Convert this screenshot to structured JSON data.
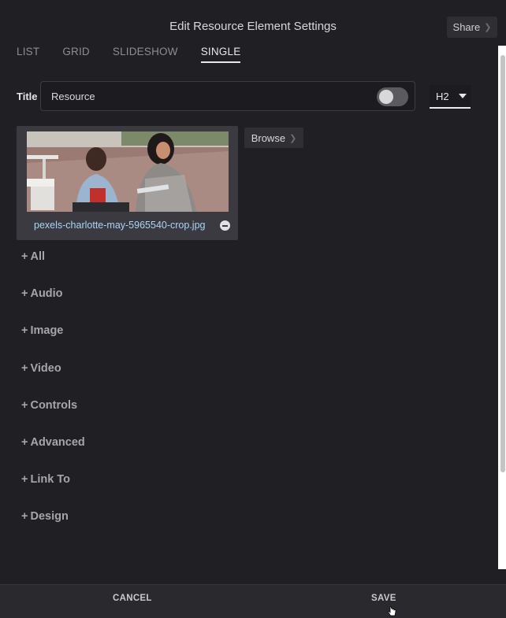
{
  "header": {
    "title": "Edit Resource Element Settings",
    "share_label": "Share"
  },
  "tabs": [
    {
      "label": "LIST",
      "active": false
    },
    {
      "label": "GRID",
      "active": false
    },
    {
      "label": "SLIDESHOW",
      "active": false
    },
    {
      "label": "SINGLE",
      "active": true
    }
  ],
  "title_field": {
    "label": "Title",
    "value": "Resource",
    "toggle_on": false
  },
  "heading_select": {
    "value": "H2"
  },
  "resource": {
    "file_name": "pexels-charlotte-may-5965540-crop.jpg",
    "browse_label": "Browse"
  },
  "sections": [
    "All",
    "Audio",
    "Image",
    "Video",
    "Controls",
    "Advanced",
    "Link To",
    "Design"
  ],
  "footer": {
    "cancel_label": "CANCEL",
    "save_label": "SAVE"
  },
  "colors": {
    "background": "#202024",
    "link": "#a8d6f5",
    "text": "#d6d6d9"
  }
}
